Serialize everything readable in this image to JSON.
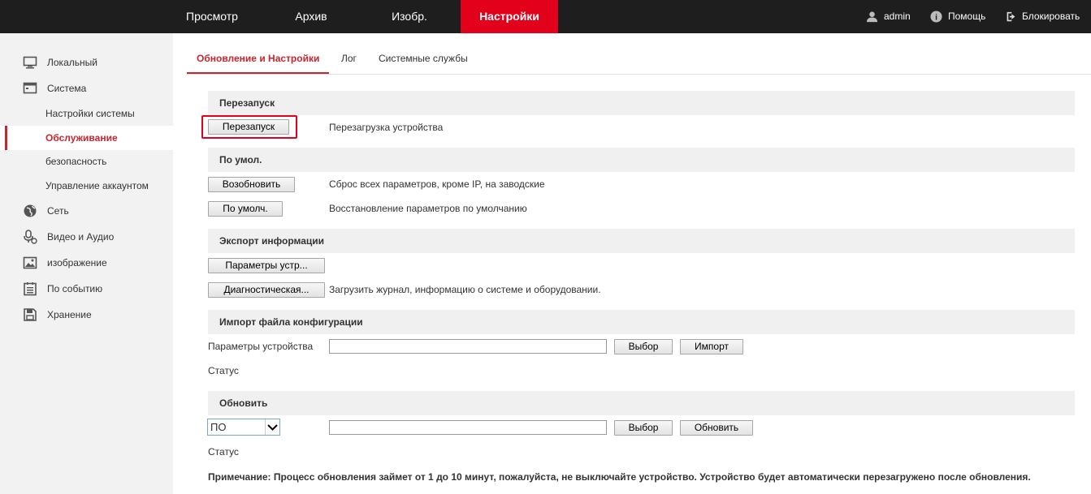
{
  "topnav": {
    "items": [
      {
        "label": "Просмотр",
        "active": false
      },
      {
        "label": "Архив",
        "active": false
      },
      {
        "label": "Изобр.",
        "active": false
      },
      {
        "label": "Настройки",
        "active": true
      }
    ],
    "user": "admin",
    "help": "Помощь",
    "lock": "Блокировать"
  },
  "sidebar": {
    "items": [
      {
        "label": "Локальный",
        "icon": "monitor-icon"
      },
      {
        "label": "Система",
        "icon": "system-icon"
      },
      {
        "label": "Сеть",
        "icon": "globe-icon"
      },
      {
        "label": "Видео и Аудио",
        "icon": "microphone-icon"
      },
      {
        "label": "изображение",
        "icon": "image-icon"
      },
      {
        "label": "По событию",
        "icon": "event-icon"
      },
      {
        "label": "Хранение",
        "icon": "storage-icon"
      }
    ],
    "system_sub": [
      {
        "label": "Настройки системы",
        "active": false
      },
      {
        "label": "Обслуживание",
        "active": true
      },
      {
        "label": "безопасность",
        "active": false
      },
      {
        "label": "Управление аккаунтом",
        "active": false
      }
    ]
  },
  "tabs": [
    {
      "label": "Обновление и Настройки",
      "active": true
    },
    {
      "label": "Лог",
      "active": false
    },
    {
      "label": "Системные службы",
      "active": false
    }
  ],
  "sections": {
    "reboot": {
      "title": "Перезапуск",
      "button": "Перезапуск",
      "desc": "Перезагрузка устройства"
    },
    "default": {
      "title": "По умол.",
      "restore_button": "Возобновить",
      "restore_desc": "Сброс всех параметров, кроме IP, на заводские",
      "default_button": "По умолч.",
      "default_desc": "Восстановление параметров по умолчанию"
    },
    "export": {
      "title": "Экспорт информации",
      "params_button": "Параметры устр...",
      "diag_button": "Диагностическая...",
      "diag_desc": "Загрузить журнал, информацию о системе и оборудовании."
    },
    "import": {
      "title": "Импорт файла конфигурации",
      "label": "Параметры устройства",
      "value": "",
      "browse_button": "Выбор",
      "import_button": "Импорт",
      "status_label": "Статус"
    },
    "upgrade": {
      "title": "Обновить",
      "select_value": "ПО",
      "value": "",
      "browse_button": "Выбор",
      "upgrade_button": "Обновить",
      "status_label": "Статус",
      "note": "Примечание: Процесс обновления займет от 1 до 10 минут, пожалуйста, не выключайте устройство. Устройство будет автоматически перезагружено после обновления."
    }
  },
  "colors": {
    "accent": "#e3001b",
    "topbar": "#1e1e1e",
    "active_text": "#c8262e"
  }
}
